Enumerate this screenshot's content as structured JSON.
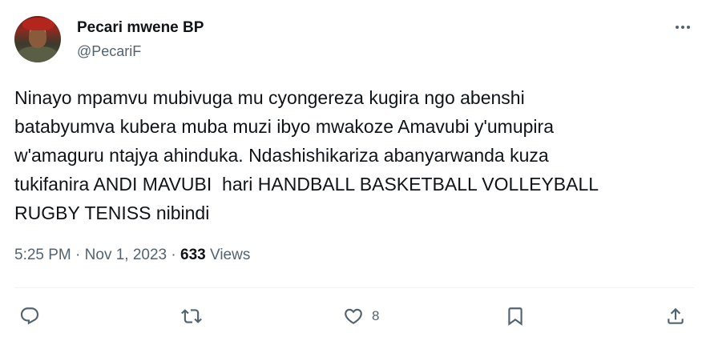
{
  "author": {
    "name": "Pecari mwene BP",
    "handle": "@PecariF"
  },
  "tweet": {
    "text": "Ninayo mpamvu mubivuga mu cyongereza kugira ngo abenshi\nbatabyumva kubera muba muzi ibyo mwakoze Amavubi y'umupira\nw'amaguru ntajya ahinduka. Ndashishikariza abanyarwanda kuza\ntukifanira ANDI MAVUBI  hari HANDBALL BASKETBALL VOLLEYBALL\nRUGBY TENISS nibindi",
    "time": "5:25 PM",
    "separator": "·",
    "date": "Nov 1, 2023",
    "views_count": "633",
    "views_label": "Views"
  },
  "actions": {
    "reply_count": "",
    "retweet_count": "",
    "like_count": "8"
  },
  "icons": {
    "more": "more-dots-icon",
    "reply": "reply-icon",
    "retweet": "retweet-icon",
    "like": "heart-icon",
    "bookmark": "bookmark-icon",
    "share": "share-icon"
  },
  "colors": {
    "text": "#0f1419",
    "secondary": "#536471",
    "divider": "#eff3f4"
  }
}
